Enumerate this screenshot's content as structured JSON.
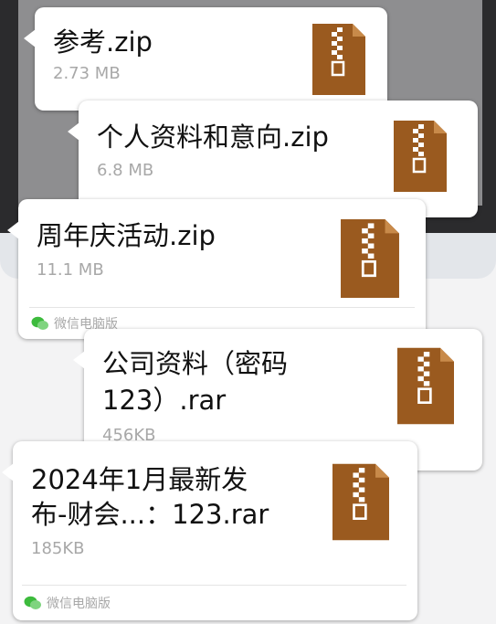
{
  "files": [
    {
      "name": "参考.zip",
      "size": "2.73 MB",
      "icon": "zip-archive-icon"
    },
    {
      "name": "个人资料和意向.zip",
      "size": "6.8 MB",
      "icon": "zip-archive-icon"
    },
    {
      "name": "周年庆活动.zip",
      "size": "11.1 MB",
      "icon": "zip-archive-icon",
      "source": "微信电脑版"
    },
    {
      "name_line1": "公司资料（密码",
      "name_line2": "123）.rar",
      "size": "456KB",
      "icon": "zip-archive-icon"
    },
    {
      "name_line1": "2024年1月最新发",
      "name_line2": "布-财会...：123.rar",
      "size": "185KB",
      "icon": "zip-archive-icon",
      "source": "微信电脑版"
    }
  ],
  "colors": {
    "archive_brown": "#9a5a1f",
    "wechat_green": "#3dbb3d"
  }
}
